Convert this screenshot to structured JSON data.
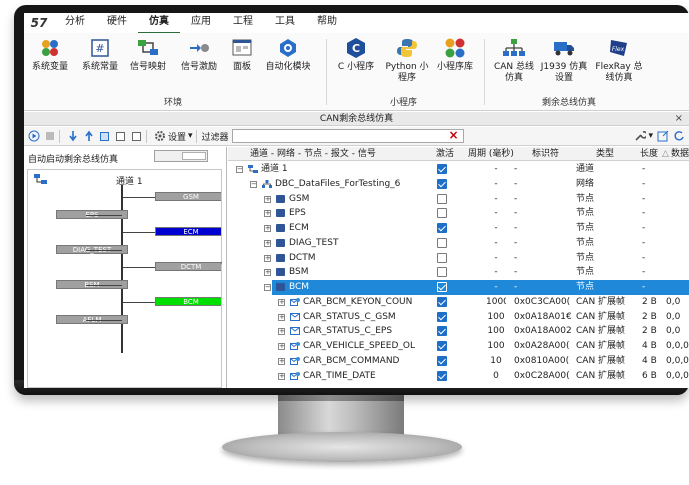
{
  "app": {
    "logo": "57",
    "menu": [
      "分析",
      "硬件",
      "仿真",
      "应用",
      "工程",
      "工具",
      "帮助"
    ],
    "active_menu": "仿真"
  },
  "ribbon": {
    "buttons": [
      {
        "label": "系统变量"
      },
      {
        "label": "系统常量"
      },
      {
        "label": "信号映射"
      },
      {
        "label": "信号激励"
      },
      {
        "label": "面板"
      },
      {
        "label": "自动化模块"
      },
      {
        "label": "C 小程序"
      },
      {
        "label": "Python 小程序"
      },
      {
        "label": "小程序库"
      },
      {
        "label": "CAN 总线仿真"
      },
      {
        "label": "J1939 仿真设置"
      },
      {
        "label": "FlexRay 总线仿真"
      }
    ],
    "groups": [
      "环境",
      "小程序",
      "剩余总线仿真"
    ]
  },
  "window": {
    "title": "CAN剩余总线仿真",
    "close": "×"
  },
  "toolbar": {
    "settings": "设置",
    "filter_label": "过滤器",
    "clear": "×"
  },
  "left": {
    "autostart": "自动启动剩余总线仿真",
    "bus_label": "通道 1",
    "nodes": [
      {
        "name": "GSM",
        "side": "right",
        "color": "#a0a0a0"
      },
      {
        "name": "EPS",
        "side": "left",
        "color": "#a0a0a0"
      },
      {
        "name": "ECM",
        "side": "right",
        "color": "#0000d0"
      },
      {
        "name": "DIAG_TEST",
        "side": "left",
        "color": "#a0a0a0"
      },
      {
        "name": "DCTM",
        "side": "right",
        "color": "#a0a0a0"
      },
      {
        "name": "BSM",
        "side": "left",
        "color": "#a0a0a0"
      },
      {
        "name": "BCM",
        "side": "right",
        "color": "#00e000"
      },
      {
        "name": "AFLM",
        "side": "left",
        "color": "#a0a0a0"
      }
    ]
  },
  "grid": {
    "headers": [
      "通道 - 网络 - 节点 - 报文 - 信号",
      "激活",
      "周期 (毫秒)",
      "标识符",
      "类型",
      "长度",
      "数据"
    ],
    "sort_indicator": "△",
    "rows": [
      {
        "level": 0,
        "icon": "bus",
        "name": "通道 1",
        "active": true,
        "period": "-",
        "id": "-",
        "type": "通道",
        "len": "-",
        "data": ""
      },
      {
        "level": 1,
        "icon": "network",
        "name": "DBC_DataFiles_ForTesting_6",
        "active": true,
        "period": "-",
        "id": "-",
        "type": "网络",
        "len": "-",
        "data": ""
      },
      {
        "level": 2,
        "icon": "folder",
        "name": "GSM",
        "active": false,
        "period": "-",
        "id": "-",
        "type": "节点",
        "len": "-",
        "data": ""
      },
      {
        "level": 2,
        "icon": "folder",
        "name": "EPS",
        "active": false,
        "period": "-",
        "id": "-",
        "type": "节点",
        "len": "-",
        "data": ""
      },
      {
        "level": 2,
        "icon": "folder",
        "name": "ECM",
        "active": true,
        "period": "-",
        "id": "-",
        "type": "节点",
        "len": "-",
        "data": ""
      },
      {
        "level": 2,
        "icon": "folder",
        "name": "DIAG_TEST",
        "active": false,
        "period": "-",
        "id": "-",
        "type": "节点",
        "len": "-",
        "data": ""
      },
      {
        "level": 2,
        "icon": "folder",
        "name": "DCTM",
        "active": false,
        "period": "-",
        "id": "-",
        "type": "节点",
        "len": "-",
        "data": ""
      },
      {
        "level": 2,
        "icon": "folder",
        "name": "BSM",
        "active": false,
        "period": "-",
        "id": "-",
        "type": "节点",
        "len": "-",
        "data": ""
      },
      {
        "level": 2,
        "icon": "folder",
        "name": "BCM",
        "active": true,
        "period": "-",
        "id": "-",
        "type": "节点",
        "len": "-",
        "data": "",
        "selected": true
      },
      {
        "level": 3,
        "icon": "msg-rx",
        "name": "CAR_BCM_KEYON_COUN",
        "active": true,
        "period": "1000",
        "id": "0x0C3CA00(",
        "type": "CAN 扩展帧",
        "len": "2 B",
        "data": "0,0"
      },
      {
        "level": 3,
        "icon": "msg-tx",
        "name": "CAR_STATUS_C_GSM",
        "active": true,
        "period": "100",
        "id": "0x0A18A01€",
        "type": "CAN 扩展帧",
        "len": "2 B",
        "data": "0,0"
      },
      {
        "level": 3,
        "icon": "msg-tx",
        "name": "CAR_STATUS_C_EPS",
        "active": true,
        "period": "100",
        "id": "0x0A18A002",
        "type": "CAN 扩展帧",
        "len": "2 B",
        "data": "0,0"
      },
      {
        "level": 3,
        "icon": "msg-rx",
        "name": "CAR_VEHICLE_SPEED_OL",
        "active": true,
        "period": "100",
        "id": "0x0A28A00(",
        "type": "CAN 扩展帧",
        "len": "4 B",
        "data": "0,0,0,0"
      },
      {
        "level": 3,
        "icon": "msg-rx",
        "name": "CAR_BCM_COMMAND",
        "active": true,
        "period": "10",
        "id": "0x0810A00(",
        "type": "CAN 扩展帧",
        "len": "4 B",
        "data": "0,0,0,0"
      },
      {
        "level": 3,
        "icon": "msg-rx",
        "name": "CAR_TIME_DATE",
        "active": true,
        "period": "0",
        "id": "0x0C28A00(",
        "type": "CAN 扩展帧",
        "len": "6 B",
        "data": "0,0,0,0,("
      }
    ]
  },
  "colors": {
    "accent": "#1f88d8",
    "menu_active": "#2d6c3a",
    "bezel": "#161616"
  }
}
